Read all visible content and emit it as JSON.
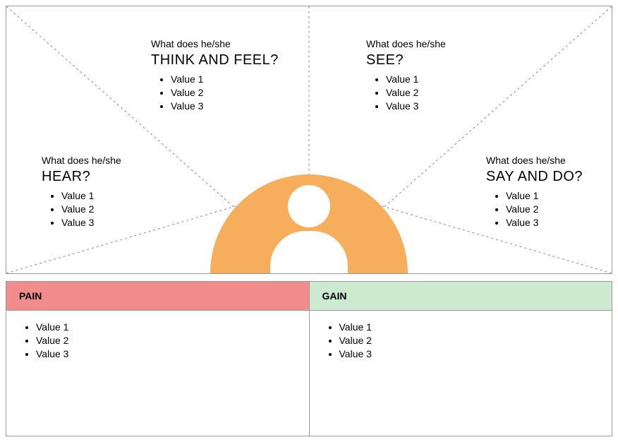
{
  "prompt_prefix": "What does he/she",
  "segments": {
    "think": {
      "title": "THINK AND FEEL?",
      "items": [
        "Value 1",
        "Value 2",
        "Value 3"
      ]
    },
    "see": {
      "title": "SEE?",
      "items": [
        "Value 1",
        "Value 2",
        "Value 3"
      ]
    },
    "hear": {
      "title": "HEAR?",
      "items": [
        "Value 1",
        "Value 2",
        "Value 3"
      ]
    },
    "say": {
      "title": "SAY AND DO?",
      "items": [
        "Value 1",
        "Value 2",
        "Value 3"
      ]
    }
  },
  "pain": {
    "title": "PAIN",
    "items": [
      "Value 1",
      "Value 2",
      "Value 3"
    ]
  },
  "gain": {
    "title": "GAIN",
    "items": [
      "Value 1",
      "Value 2",
      "Value 3"
    ]
  },
  "colors": {
    "avatar_bg": "#f6ae5c",
    "pain_bg": "#f28b8b",
    "gain_bg": "#cde9cf",
    "border": "#999999"
  }
}
